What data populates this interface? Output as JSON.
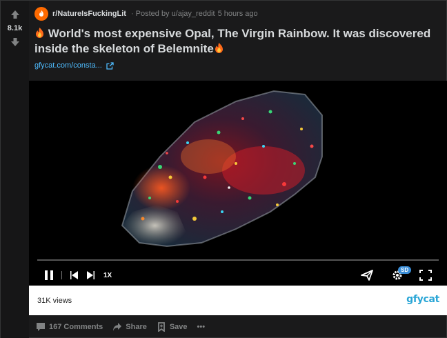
{
  "post": {
    "score": "8.1k",
    "subreddit": "r/NatureIsFuckingLit",
    "separator": "·",
    "posted_by": "Posted by",
    "user": "u/ajay_reddit",
    "time": "5 hours ago",
    "title": "World's most expensive Opal, The Virgin Rainbow. It was discovered inside the skeleton of Belemnite",
    "link_text": "gfycat.com/consta...",
    "views": "31K views",
    "gfy_logo": "gfycat",
    "video": {
      "speed": "1X",
      "quality": "SD",
      "progress_percent": 0
    },
    "actions": {
      "comments": "167 Comments",
      "share": "Share",
      "save": "Save",
      "more": "•••"
    }
  },
  "icons": {
    "upvote": "upvote-arrow-icon",
    "downvote": "downvote-arrow-icon",
    "subreddit": "subreddit-avatar-icon",
    "flame": "fire-emoji-icon",
    "external": "external-link-icon",
    "pause": "pause-icon",
    "prev": "previous-frame-icon",
    "next": "next-frame-icon",
    "share_video": "send-icon",
    "settings": "gear-icon",
    "fullscreen": "fullscreen-icon",
    "comment": "comment-icon",
    "share": "share-arrow-icon",
    "save": "bookmark-icon"
  },
  "colors": {
    "background": "#1a1a1b",
    "accent_link": "#4fbcff",
    "subreddit_orange": "#ff6a00",
    "muted": "#818384",
    "text": "#d7dadc",
    "gfycat_blue": "#2aa6d6"
  }
}
